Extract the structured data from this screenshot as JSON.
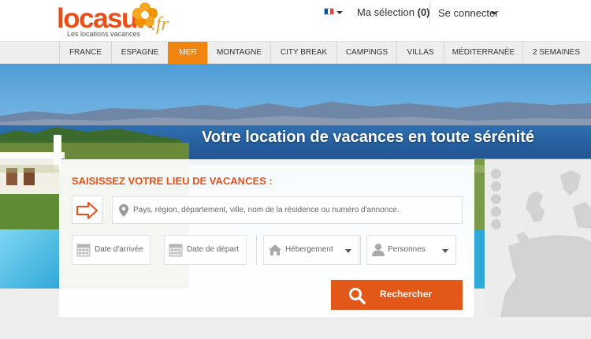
{
  "header": {
    "logo": {
      "word": "locasun",
      "ext": ".fr",
      "tagline": "Les locations vacances"
    },
    "language": {
      "flag": "fr-flag-icon",
      "colors": [
        "#0055a4",
        "#ffffff",
        "#ef4135"
      ]
    },
    "selection": {
      "label": "Ma sélection",
      "count": "(0)"
    },
    "login": {
      "label": "Se connecter"
    }
  },
  "nav": {
    "items": [
      {
        "label": "FRANCE",
        "active": false
      },
      {
        "label": "ESPAGNE",
        "active": false
      },
      {
        "label": "MER",
        "active": true
      },
      {
        "label": "MONTAGNE",
        "active": false
      },
      {
        "label": "CITY BREAK",
        "active": false
      },
      {
        "label": "CAMPINGS",
        "active": false
      },
      {
        "label": "VILLAS",
        "active": false
      },
      {
        "label": "MÉDITERRANÉE",
        "active": false
      },
      {
        "label": "2 SEMAINES",
        "active": false
      }
    ]
  },
  "hero": {
    "title": "Votre location de vacances en toute sérénité"
  },
  "search": {
    "title": "SAISISSEZ VOTRE LIEU DE VACANCES :",
    "place_placeholder": "Pays, région, département, ville, nom de la résidence ou numéro d'annonce.",
    "arrival_label": "Date d'arrivée",
    "departure_label": "Date de départ",
    "lodging_label": "Hébergement",
    "persons_label": "Personnes",
    "submit_label": "Rechercher"
  },
  "colors": {
    "brand_orange": "#e8501a",
    "nav_active": "#f0850f",
    "button": "#e25818"
  }
}
